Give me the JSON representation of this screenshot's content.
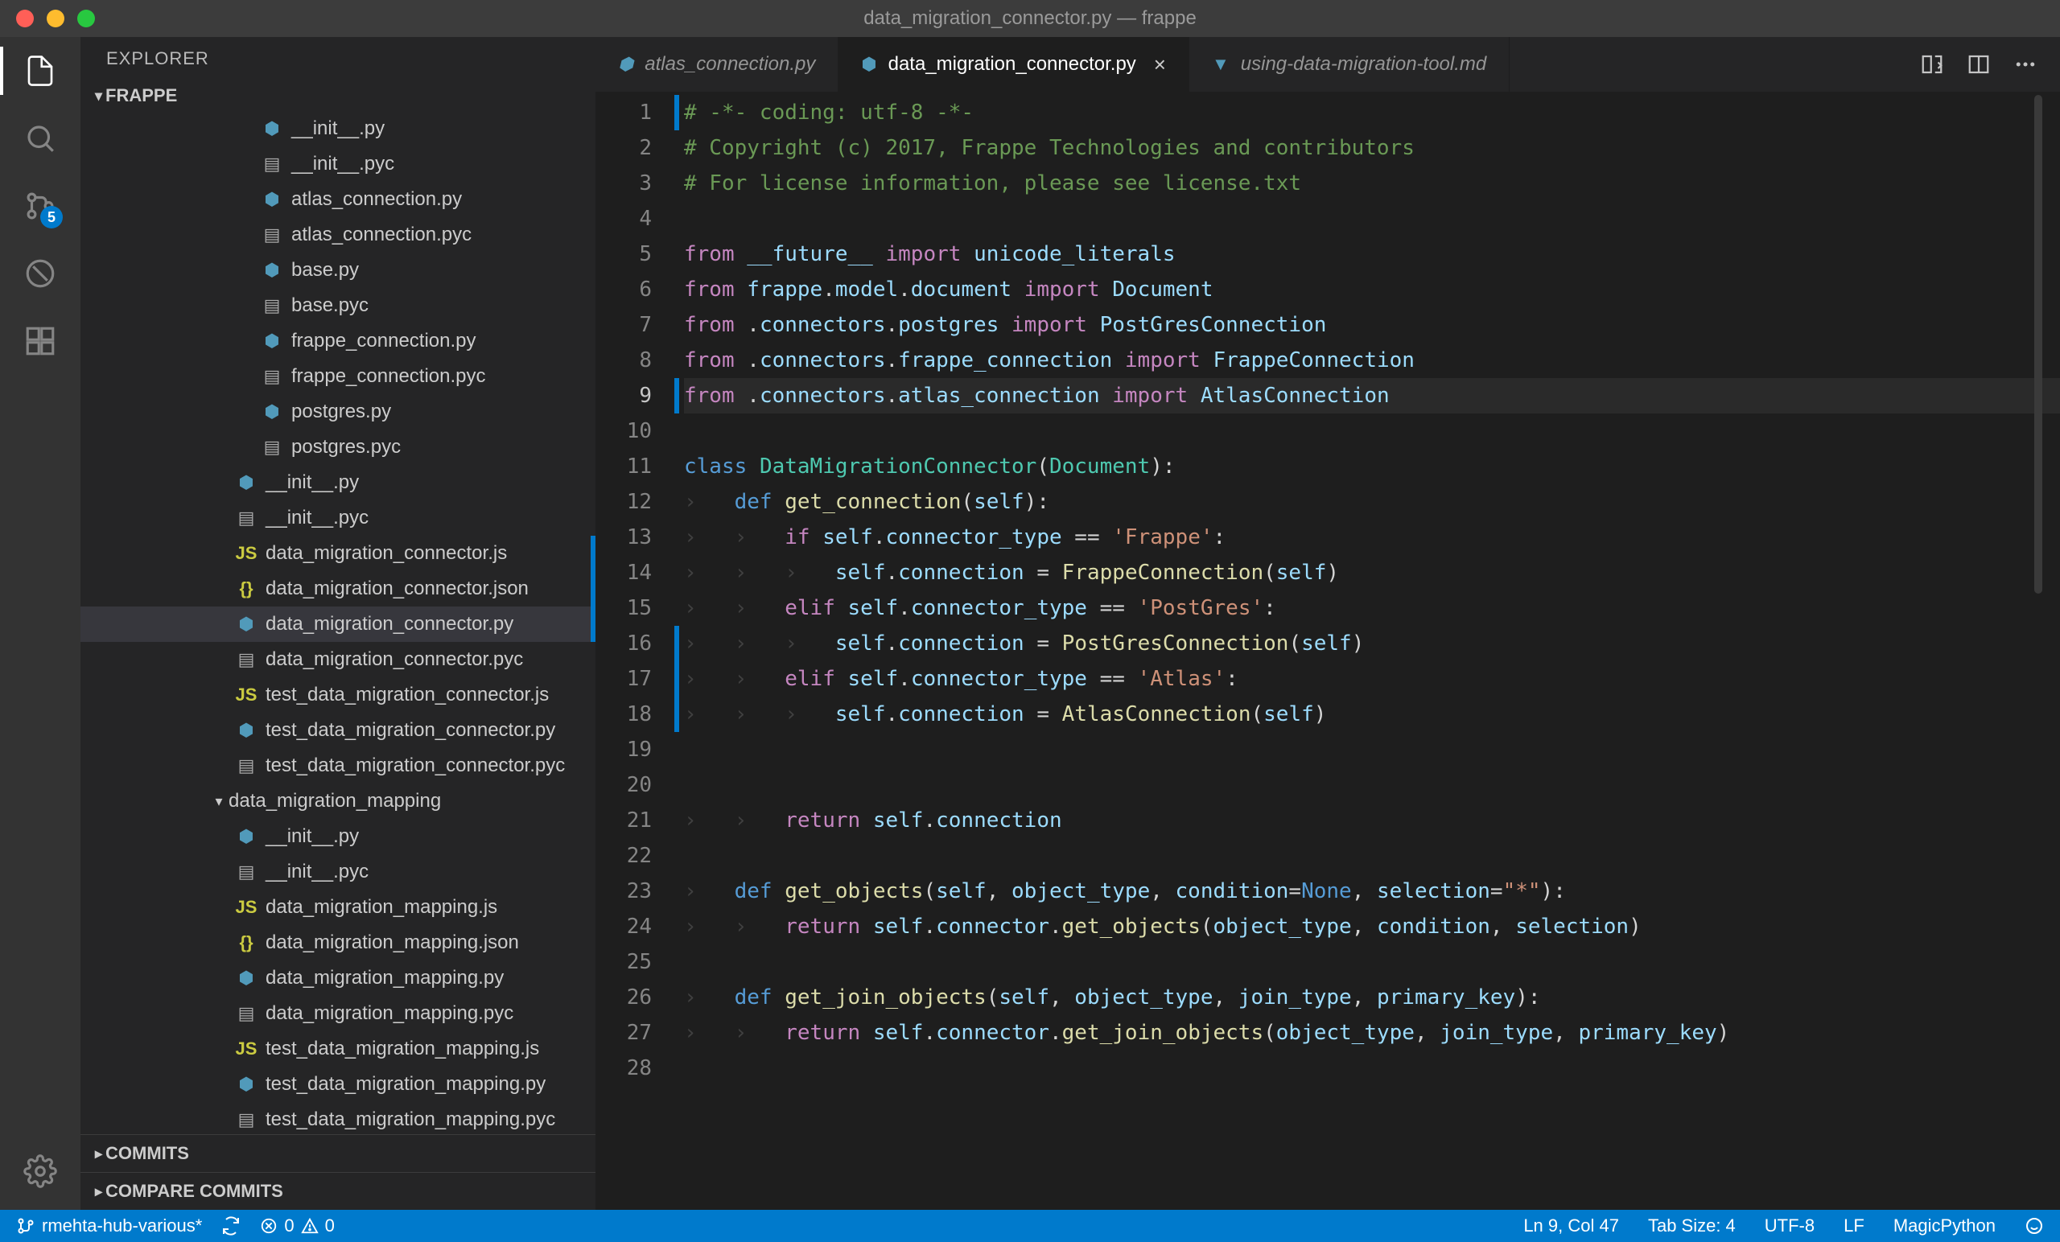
{
  "window": {
    "title": "data_migration_connector.py — frappe"
  },
  "activity": {
    "scm_badge": "5"
  },
  "sidebar": {
    "title": "EXPLORER",
    "root": "FRAPPE",
    "files": [
      {
        "name": "__init__.py",
        "icon": "py",
        "indent": 224
      },
      {
        "name": "__init__.pyc",
        "icon": "bin",
        "indent": 224
      },
      {
        "name": "atlas_connection.py",
        "icon": "py",
        "indent": 224
      },
      {
        "name": "atlas_connection.pyc",
        "icon": "bin",
        "indent": 224
      },
      {
        "name": "base.py",
        "icon": "py",
        "indent": 224
      },
      {
        "name": "base.pyc",
        "icon": "bin",
        "indent": 224
      },
      {
        "name": "frappe_connection.py",
        "icon": "py",
        "indent": 224
      },
      {
        "name": "frappe_connection.pyc",
        "icon": "bin",
        "indent": 224
      },
      {
        "name": "postgres.py",
        "icon": "py",
        "indent": 224
      },
      {
        "name": "postgres.pyc",
        "icon": "bin",
        "indent": 224
      },
      {
        "name": "__init__.py",
        "icon": "py",
        "indent": 192
      },
      {
        "name": "__init__.pyc",
        "icon": "bin",
        "indent": 192
      },
      {
        "name": "data_migration_connector.js",
        "icon": "js",
        "indent": 192,
        "modified": true
      },
      {
        "name": "data_migration_connector.json",
        "icon": "json",
        "indent": 192,
        "modified": true
      },
      {
        "name": "data_migration_connector.py",
        "icon": "py",
        "indent": 192,
        "selected": true,
        "modified": true
      },
      {
        "name": "data_migration_connector.pyc",
        "icon": "bin",
        "indent": 192
      },
      {
        "name": "test_data_migration_connector.js",
        "icon": "js",
        "indent": 192
      },
      {
        "name": "test_data_migration_connector.py",
        "icon": "py",
        "indent": 192
      },
      {
        "name": "test_data_migration_connector.pyc",
        "icon": "bin",
        "indent": 192
      },
      {
        "name": "data_migration_mapping",
        "icon": "folder",
        "indent": 160,
        "folder": true
      },
      {
        "name": "__init__.py",
        "icon": "py",
        "indent": 192
      },
      {
        "name": "__init__.pyc",
        "icon": "bin",
        "indent": 192
      },
      {
        "name": "data_migration_mapping.js",
        "icon": "js",
        "indent": 192
      },
      {
        "name": "data_migration_mapping.json",
        "icon": "json",
        "indent": 192
      },
      {
        "name": "data_migration_mapping.py",
        "icon": "py",
        "indent": 192
      },
      {
        "name": "data_migration_mapping.pyc",
        "icon": "bin",
        "indent": 192
      },
      {
        "name": "test_data_migration_mapping.js",
        "icon": "js",
        "indent": 192
      },
      {
        "name": "test_data_migration_mapping.py",
        "icon": "py",
        "indent": 192
      },
      {
        "name": "test_data_migration_mapping.pyc",
        "icon": "bin",
        "indent": 192
      }
    ],
    "bottom_sections": [
      "COMMITS",
      "COMPARE COMMITS"
    ]
  },
  "tabs": [
    {
      "label": "atlas_connection.py",
      "icon": "py",
      "active": false
    },
    {
      "label": "data_migration_connector.py",
      "icon": "py",
      "active": true,
      "close": true
    },
    {
      "label": "using-data-migration-tool.md",
      "icon": "md",
      "active": false
    }
  ],
  "code": {
    "current_line": 9,
    "lines": [
      [
        [
          "comment",
          "# -*- coding: utf-8 -*-"
        ]
      ],
      [
        [
          "comment",
          "# Copyright (c) 2017, Frappe Technologies and contributors"
        ]
      ],
      [
        [
          "comment",
          "# For license information, please see license.txt"
        ]
      ],
      [],
      [
        [
          "keyword",
          "from"
        ],
        [
          "op",
          " "
        ],
        [
          "var",
          "__future__"
        ],
        [
          "op",
          " "
        ],
        [
          "keyword",
          "import"
        ],
        [
          "op",
          " "
        ],
        [
          "var",
          "unicode_literals"
        ]
      ],
      [
        [
          "keyword",
          "from"
        ],
        [
          "op",
          " "
        ],
        [
          "var",
          "frappe"
        ],
        [
          "punc",
          "."
        ],
        [
          "var",
          "model"
        ],
        [
          "punc",
          "."
        ],
        [
          "var",
          "document"
        ],
        [
          "op",
          " "
        ],
        [
          "keyword",
          "import"
        ],
        [
          "op",
          " "
        ],
        [
          "var",
          "Document"
        ]
      ],
      [
        [
          "keyword",
          "from"
        ],
        [
          "op",
          " "
        ],
        [
          "punc",
          "."
        ],
        [
          "var",
          "connectors"
        ],
        [
          "punc",
          "."
        ],
        [
          "var",
          "postgres"
        ],
        [
          "op",
          " "
        ],
        [
          "keyword",
          "import"
        ],
        [
          "op",
          " "
        ],
        [
          "var",
          "PostGresConnection"
        ]
      ],
      [
        [
          "keyword",
          "from"
        ],
        [
          "op",
          " "
        ],
        [
          "punc",
          "."
        ],
        [
          "var",
          "connectors"
        ],
        [
          "punc",
          "."
        ],
        [
          "var",
          "frappe_connection"
        ],
        [
          "op",
          " "
        ],
        [
          "keyword",
          "import"
        ],
        [
          "op",
          " "
        ],
        [
          "var",
          "FrappeConnection"
        ]
      ],
      [
        [
          "keyword",
          "from"
        ],
        [
          "op",
          " "
        ],
        [
          "punc",
          "."
        ],
        [
          "var",
          "connectors"
        ],
        [
          "punc",
          "."
        ],
        [
          "var",
          "atlas_connection"
        ],
        [
          "op",
          " "
        ],
        [
          "keyword",
          "import"
        ],
        [
          "op",
          " "
        ],
        [
          "var",
          "AtlasConnection"
        ]
      ],
      [],
      [
        [
          "keyword2",
          "class"
        ],
        [
          "op",
          " "
        ],
        [
          "class",
          "DataMigrationConnector"
        ],
        [
          "punc",
          "("
        ],
        [
          "class",
          "Document"
        ],
        [
          "punc",
          ")"
        ],
        [
          "punc",
          ":"
        ]
      ],
      [
        [
          "ws",
          "›   "
        ],
        [
          "keyword2",
          "def"
        ],
        [
          "op",
          " "
        ],
        [
          "func",
          "get_connection"
        ],
        [
          "punc",
          "("
        ],
        [
          "self",
          "self"
        ],
        [
          "punc",
          ")"
        ],
        [
          "punc",
          ":"
        ]
      ],
      [
        [
          "ws",
          "›   ›   "
        ],
        [
          "keyword",
          "if"
        ],
        [
          "op",
          " "
        ],
        [
          "self",
          "self"
        ],
        [
          "punc",
          "."
        ],
        [
          "var",
          "connector_type"
        ],
        [
          "op",
          " == "
        ],
        [
          "string",
          "'Frappe'"
        ],
        [
          "punc",
          ":"
        ]
      ],
      [
        [
          "ws",
          "›   ›   ›   "
        ],
        [
          "self",
          "self"
        ],
        [
          "punc",
          "."
        ],
        [
          "var",
          "connection"
        ],
        [
          "op",
          " = "
        ],
        [
          "func",
          "FrappeConnection"
        ],
        [
          "punc",
          "("
        ],
        [
          "self",
          "self"
        ],
        [
          "punc",
          ")"
        ]
      ],
      [
        [
          "ws",
          "›   ›   "
        ],
        [
          "keyword",
          "elif"
        ],
        [
          "op",
          " "
        ],
        [
          "self",
          "self"
        ],
        [
          "punc",
          "."
        ],
        [
          "var",
          "connector_type"
        ],
        [
          "op",
          " == "
        ],
        [
          "string",
          "'PostGres'"
        ],
        [
          "punc",
          ":"
        ]
      ],
      [
        [
          "ws",
          "›   ›   ›   "
        ],
        [
          "self",
          "self"
        ],
        [
          "punc",
          "."
        ],
        [
          "var",
          "connection"
        ],
        [
          "op",
          " = "
        ],
        [
          "func",
          "PostGresConnection"
        ],
        [
          "punc",
          "("
        ],
        [
          "self",
          "self"
        ],
        [
          "punc",
          ")"
        ]
      ],
      [
        [
          "ws",
          "›   ›   "
        ],
        [
          "keyword",
          "elif"
        ],
        [
          "op",
          " "
        ],
        [
          "self",
          "self"
        ],
        [
          "punc",
          "."
        ],
        [
          "var",
          "connector_type"
        ],
        [
          "op",
          " == "
        ],
        [
          "string",
          "'Atlas'"
        ],
        [
          "punc",
          ":"
        ]
      ],
      [
        [
          "ws",
          "›   ›   ›   "
        ],
        [
          "self",
          "self"
        ],
        [
          "punc",
          "."
        ],
        [
          "var",
          "connection"
        ],
        [
          "op",
          " = "
        ],
        [
          "func",
          "AtlasConnection"
        ],
        [
          "punc",
          "("
        ],
        [
          "self",
          "self"
        ],
        [
          "punc",
          ")"
        ]
      ],
      [],
      [],
      [
        [
          "ws",
          "›   ›   "
        ],
        [
          "keyword",
          "return"
        ],
        [
          "op",
          " "
        ],
        [
          "self",
          "self"
        ],
        [
          "punc",
          "."
        ],
        [
          "var",
          "connection"
        ]
      ],
      [],
      [
        [
          "ws",
          "›   "
        ],
        [
          "keyword2",
          "def"
        ],
        [
          "op",
          " "
        ],
        [
          "func",
          "get_objects"
        ],
        [
          "punc",
          "("
        ],
        [
          "self",
          "self"
        ],
        [
          "punc",
          ", "
        ],
        [
          "var",
          "object_type"
        ],
        [
          "punc",
          ", "
        ],
        [
          "var",
          "condition"
        ],
        [
          "op",
          "="
        ],
        [
          "num",
          "None"
        ],
        [
          "punc",
          ", "
        ],
        [
          "var",
          "selection"
        ],
        [
          "op",
          "="
        ],
        [
          "string",
          "\"*\""
        ],
        [
          "punc",
          ")"
        ],
        [
          "punc",
          ":"
        ]
      ],
      [
        [
          "ws",
          "›   ›   "
        ],
        [
          "keyword",
          "return"
        ],
        [
          "op",
          " "
        ],
        [
          "self",
          "self"
        ],
        [
          "punc",
          "."
        ],
        [
          "var",
          "connector"
        ],
        [
          "punc",
          "."
        ],
        [
          "func",
          "get_objects"
        ],
        [
          "punc",
          "("
        ],
        [
          "var",
          "object_type"
        ],
        [
          "punc",
          ", "
        ],
        [
          "var",
          "condition"
        ],
        [
          "punc",
          ", "
        ],
        [
          "var",
          "selection"
        ],
        [
          "punc",
          ")"
        ]
      ],
      [],
      [
        [
          "ws",
          "›   "
        ],
        [
          "keyword2",
          "def"
        ],
        [
          "op",
          " "
        ],
        [
          "func",
          "get_join_objects"
        ],
        [
          "punc",
          "("
        ],
        [
          "self",
          "self"
        ],
        [
          "punc",
          ", "
        ],
        [
          "var",
          "object_type"
        ],
        [
          "punc",
          ", "
        ],
        [
          "var",
          "join_type"
        ],
        [
          "punc",
          ", "
        ],
        [
          "var",
          "primary_key"
        ],
        [
          "punc",
          ")"
        ],
        [
          "punc",
          ":"
        ]
      ],
      [
        [
          "ws",
          "›   ›   "
        ],
        [
          "keyword",
          "return"
        ],
        [
          "op",
          " "
        ],
        [
          "self",
          "self"
        ],
        [
          "punc",
          "."
        ],
        [
          "var",
          "connector"
        ],
        [
          "punc",
          "."
        ],
        [
          "func",
          "get_join_objects"
        ],
        [
          "punc",
          "("
        ],
        [
          "var",
          "object_type"
        ],
        [
          "punc",
          ", "
        ],
        [
          "var",
          "join_type"
        ],
        [
          "punc",
          ", "
        ],
        [
          "var",
          "primary_key"
        ],
        [
          "punc",
          ")"
        ]
      ],
      []
    ]
  },
  "statusbar": {
    "branch": "rmehta-hub-various*",
    "errors": "0",
    "warnings": "0",
    "cursor": "Ln 9, Col 47",
    "tabsize": "Tab Size: 4",
    "encoding": "UTF-8",
    "eol": "LF",
    "lang": "MagicPython"
  }
}
